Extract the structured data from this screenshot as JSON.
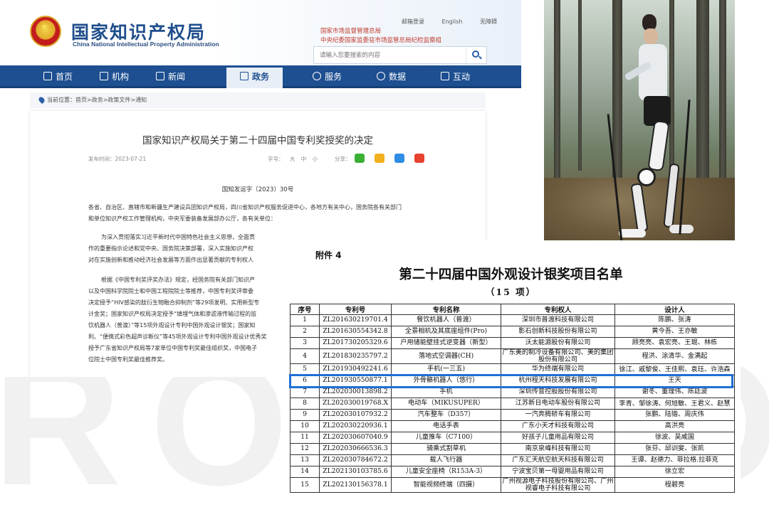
{
  "watermark": "ROBOOT",
  "site": {
    "title": "国家知识产权局",
    "subtitle": "China National Intellectual Property Administration",
    "affiliations": [
      "国家市场监督管理总局",
      "中央纪委国家监委驻市场监管总局纪检监察组"
    ],
    "top_links": [
      "邮箱登录",
      "English",
      "无障碍"
    ],
    "search_placeholder": "请输入您要搜索的内容",
    "nav": [
      {
        "label": "首页",
        "icon": "home-icon"
      },
      {
        "label": "机构",
        "icon": "building-icon"
      },
      {
        "label": "新闻",
        "icon": "news-icon"
      },
      {
        "label": "政务",
        "icon": "document-icon"
      },
      {
        "label": "服务",
        "icon": "handshake-icon"
      },
      {
        "label": "数据",
        "icon": "pie-chart-icon"
      },
      {
        "label": "互动",
        "icon": "hand-icon"
      }
    ],
    "nav_active": "政务",
    "breadcrumb": "当前位置：首页>政务>政策文件>通知",
    "article": {
      "title": "国家知识产权局关于第二十四届中国专利奖授奖的决定",
      "date": "发布时间：2023-07-21",
      "font_label": "字号：",
      "font_sizes": [
        "大",
        "中",
        "小"
      ],
      "share_label": "分享：",
      "doc_no": "国知发运字〔2023〕30号",
      "paragraphs": [
        "各省、自治区、直辖市和新疆生产建设兵团知识产权局，四川省知识产权服务促进中心，各地方有关中心，国务院各有关部门",
        "和单位知识产权工作管理机构，中央军委装备发展部办公厅，各有关单位：",
        "为深入贯彻落实习近平新时代中国特色社会主义思想，全面贯",
        "作的重要指示论述和党中央、国务院决策部署，深入实施知识产权",
        "对在实施创新和推动经济社会发展等方面作出显著贡献的专利权人",
        "根据《中国专利奖评奖办法》规定，经国务院有关部门知识产",
        "以及中国科学院院士和中国工程院院士等推荐，中国专利奖评审委",
        "决定授予“HIV感染的肽衍生物融合抑制剂”等29项发明、实用新型专",
        "计金奖；国家知识产权局决定授予“填埋气体和渗滤液传输过程的监",
        "饮机器人（普渡）”等15项外观设计专利中国外观设计银奖；国家知",
        "利、“便携式彩色超声诊断仪”等45项外观设计专利中国外观设计优秀奖",
        "授予广东省知识产权局等7家单位中国专利奖最佳组织奖，中国电子",
        "位院士中国专利奖最佳推荐奖。"
      ]
    }
  },
  "document": {
    "annex": "附件 4",
    "title": "第二十四届中国外观设计银奖项目名单",
    "count": "（15 项）",
    "headers": [
      "序号",
      "专利号",
      "专利名称",
      "专利权人",
      "设计人"
    ],
    "rows": [
      [
        "1",
        "ZL201630219701.4",
        "餐饮机器人（普渡）",
        "深圳市普渡科技有限公司",
        "陈鹏、张涛"
      ],
      [
        "2",
        "ZL201630554342.8",
        "全景相机及其底座组件(Pro)",
        "影石创新科技股份有限公司",
        "黄今吾、王亦敏"
      ],
      [
        "3",
        "ZL201730205329.6",
        "户用储能壁挂式逆变器（新型）",
        "沃太能源股份有限公司",
        "顾亮亮、袁宏亮、王琨、林栋"
      ],
      [
        "4",
        "ZL201830235797.2",
        "落地式空调器(CH)",
        "广东美的制冷设备有限公司、美的集团股份有限公司",
        "程洪、涂清华、金满起"
      ],
      [
        "5",
        "ZL201930492241.6",
        "手机(一三五)",
        "华为终端有限公司",
        "徐江、戚黎俊、王佳熙、袁珏、许浩森"
      ],
      [
        "6",
        "ZL201930550877.1",
        "外骨骼机器人（悠行）",
        "杭州程天科技发展有限公司",
        "王天"
      ],
      [
        "7",
        "ZL202030013898.2",
        "手机",
        "深圳传音控股股份有限公司",
        "谢冬、董理伟、陈廷波"
      ],
      [
        "8",
        "ZL202030019768.X",
        "电动车（MIKUSUPER）",
        "江苏新日电动车股份有限公司",
        "李青、邹徐涛、何旭敏、王君义、赵慧"
      ],
      [
        "9",
        "ZL202030107932.2",
        "汽车整车（D357）",
        "一汽奔腾轿车有限公司",
        "张鹏、陆锴、周庆伟"
      ],
      [
        "10",
        "ZL202030220936.1",
        "电话手表",
        "广东小天才科技有限公司",
        "高洪亮"
      ],
      [
        "11",
        "ZL202030607040.9",
        "儿童推车（C7100）",
        "好孩子儿童用品有限公司",
        "徐波、吴咸国"
      ],
      [
        "12",
        "ZL202030666536.3",
        "骑乘式割草机",
        "南京泉峰科技有限公司",
        "张芬、邱训斐、张凯"
      ],
      [
        "13",
        "ZL202030784672.2",
        "载人飞行器",
        "广东汇天航空航天科技有限公司",
        "王谭、赵德力、菲拉格.拉菲克"
      ],
      [
        "14",
        "ZL202130103785.6",
        "儿童安全座椅（R153A-3）",
        "宁波宝贝第一母婴用品有限公司",
        "徐立宏"
      ],
      [
        "15",
        "ZL202130156378.1",
        "智能视频终端（四摄）",
        "广州视源电子科技股份有限公司、广州视睿电子科技有限公司",
        "程碧亮"
      ]
    ],
    "highlight_row": 6,
    "highlight_color": "#1f6fd4"
  },
  "colors": {
    "nav_bg": "#1d4f91",
    "title_blue": "#1f4e8c",
    "affiliation_red": "#c0392b"
  }
}
